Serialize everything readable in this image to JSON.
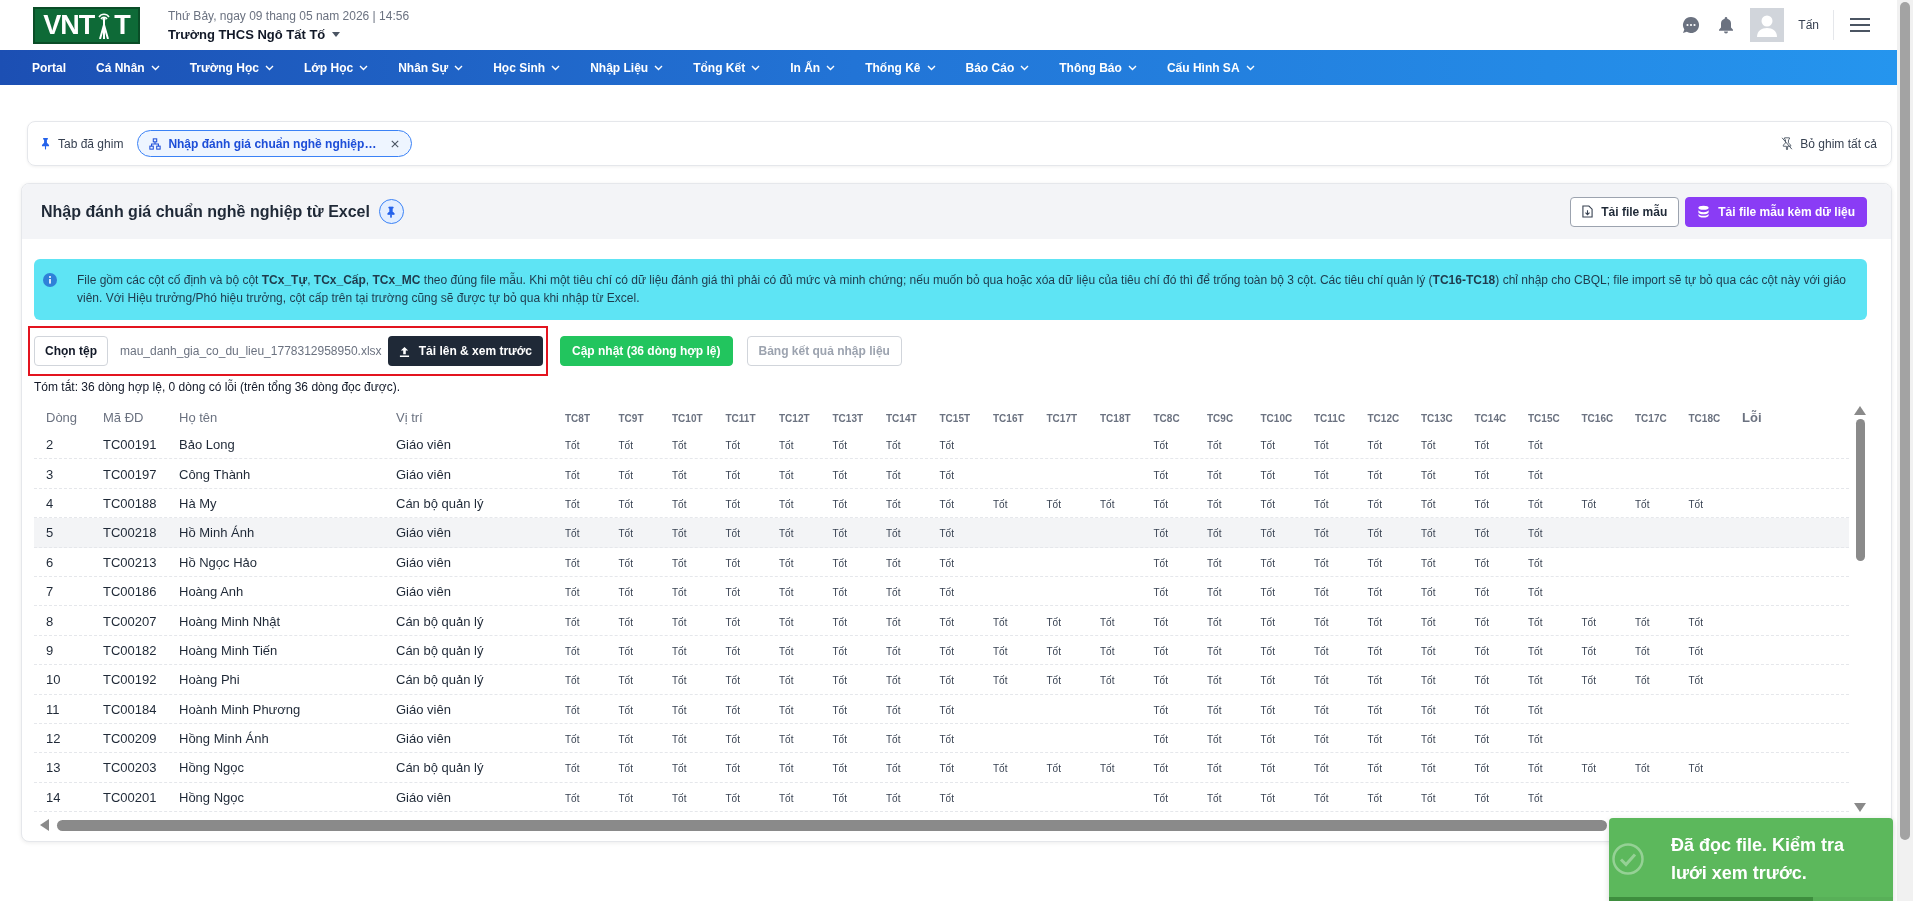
{
  "header": {
    "logo": {
      "text_left": "VNT",
      "text_right": "T"
    },
    "date_time": "Thứ Bảy, ngay 09 thang 05 nam 2026 | 14:56",
    "school": "Trường THCS Ngô Tất Tố",
    "user_name": "Tấn"
  },
  "nav": [
    {
      "label": "Portal",
      "has_menu": false
    },
    {
      "label": "Cá Nhân",
      "has_menu": true
    },
    {
      "label": "Trường Học",
      "has_menu": true
    },
    {
      "label": "Lớp Học",
      "has_menu": true
    },
    {
      "label": "Nhân Sự",
      "has_menu": true
    },
    {
      "label": "Học Sinh",
      "has_menu": true
    },
    {
      "label": "Nhập Liệu",
      "has_menu": true
    },
    {
      "label": "Tổng Kết",
      "has_menu": true
    },
    {
      "label": "In Ấn",
      "has_menu": true
    },
    {
      "label": "Thống Kê",
      "has_menu": true
    },
    {
      "label": "Báo Cáo",
      "has_menu": true
    },
    {
      "label": "Thông Báo",
      "has_menu": true
    },
    {
      "label": "Cấu Hình SA",
      "has_menu": true
    }
  ],
  "pinned_bar": {
    "label": "Tab đã ghim",
    "tabs": [
      {
        "label": "Nhập đánh giá chuẩn nghề nghiệp…",
        "selected": true
      }
    ],
    "unpin_all": "Bỏ ghim tất cả"
  },
  "page": {
    "title": "Nhập đánh giá chuẩn nghề nghiệp từ Excel",
    "pinned": true,
    "buttons": [
      {
        "label": "Tải file mẫu",
        "kind": "outline"
      },
      {
        "label": "Tải file mẫu kèm dữ liệu",
        "kind": "primary"
      }
    ]
  },
  "notice": {
    "text": "File gồm các cột cố định và bộ cột **TCx_Tự**, **TCx_Cấp**, **TCx_MC** theo đúng file mẫu. Khi một tiêu chí có dữ liệu đánh giá thì phải có đủ mức và minh chứng; nếu muốn bỏ qua hoặc xóa dữ liệu của tiêu chí đó thì để trống toàn bộ 3 cột. Các tiêu chí quản lý (**TC16-TC18**) chỉ nhập cho CBQL; file import sẽ tự bỏ qua các cột này với giáo viên. Với Hiệu trưởng/Phó hiệu trưởng, cột cấp trên tại trường cũng sẽ được tự bỏ qua khi nhập từ Excel."
  },
  "import": {
    "highlighted": true,
    "choose_button": "Chọn tệp",
    "file_name": "mau_danh_gia_co_du_lieu_1778312958950.xlsx",
    "upload_button": "Tải lên & xem trước",
    "actions": [
      {
        "label": "Cập nhật (36 dòng hợp lệ)",
        "disabled": false
      },
      {
        "label": "Bảng kết quả nhập liệu",
        "disabled": true
      }
    ]
  },
  "summary": "Tóm tắt: 36 dòng hợp lệ, 0 dòng có lỗi (trên tổng 36 dòng đọc được).",
  "table": {
    "columns": [
      {
        "label": "Dòng",
        "kind": "info"
      },
      {
        "label": "Mã ĐD",
        "kind": "info"
      },
      {
        "label": "Họ tên",
        "kind": "info"
      },
      {
        "label": "Vị trí",
        "kind": "info"
      },
      {
        "label": "TC8T",
        "kind": "rating_t"
      },
      {
        "label": "TC9T",
        "kind": "rating_t"
      },
      {
        "label": "TC10T",
        "kind": "rating_t"
      },
      {
        "label": "TC11T",
        "kind": "rating_t"
      },
      {
        "label": "TC12T",
        "kind": "rating_t"
      },
      {
        "label": "TC13T",
        "kind": "rating_t"
      },
      {
        "label": "TC14T",
        "kind": "rating_t"
      },
      {
        "label": "TC15T",
        "kind": "rating_t"
      },
      {
        "label": "TC16T",
        "kind": "rating_t"
      },
      {
        "label": "TC17T",
        "kind": "rating_t"
      },
      {
        "label": "TC18T",
        "kind": "rating_t"
      },
      {
        "label": "TC8C",
        "kind": "rating_c"
      },
      {
        "label": "TC9C",
        "kind": "rating_c"
      },
      {
        "label": "TC10C",
        "kind": "rating_c"
      },
      {
        "label": "TC11C",
        "kind": "rating_c"
      },
      {
        "label": "TC12C",
        "kind": "rating_c"
      },
      {
        "label": "TC13C",
        "kind": "rating_c"
      },
      {
        "label": "TC14C",
        "kind": "rating_c"
      },
      {
        "label": "TC15C",
        "kind": "rating_c"
      },
      {
        "label": "TC16C",
        "kind": "rating_c"
      },
      {
        "label": "TC17C",
        "kind": "rating_c"
      },
      {
        "label": "TC18C",
        "kind": "rating_c"
      },
      {
        "label": "Lỗi",
        "kind": "error"
      }
    ],
    "rows": [
      {
        "line": "2",
        "code": "TC00191",
        "name": "Bảo Long",
        "position": "Giáo viên",
        "hovered": false,
        "ratings_t": [
          "Tốt",
          "Tốt",
          "Tốt",
          "Tốt",
          "Tốt",
          "Tốt",
          "Tốt",
          "Tốt"
        ],
        "ratings_c": [
          "Tốt",
          "Tốt",
          "Tốt",
          "Tốt",
          "Tốt",
          "Tốt",
          "Tốt",
          "Tốt"
        ]
      },
      {
        "line": "3",
        "code": "TC00197",
        "name": "Công Thành",
        "position": "Giáo viên",
        "hovered": false,
        "ratings_t": [
          "Tốt",
          "Tốt",
          "Tốt",
          "Tốt",
          "Tốt",
          "Tốt",
          "Tốt",
          "Tốt"
        ],
        "ratings_c": [
          "Tốt",
          "Tốt",
          "Tốt",
          "Tốt",
          "Tốt",
          "Tốt",
          "Tốt",
          "Tốt"
        ]
      },
      {
        "line": "4",
        "code": "TC00188",
        "name": "Hà My",
        "position": "Cán bộ quản lý",
        "hovered": false,
        "ratings_t": [
          "Tốt",
          "Tốt",
          "Tốt",
          "Tốt",
          "Tốt",
          "Tốt",
          "Tốt",
          "Tốt",
          "Tốt",
          "Tốt",
          "Tốt"
        ],
        "ratings_c": [
          "Tốt",
          "Tốt",
          "Tốt",
          "Tốt",
          "Tốt",
          "Tốt",
          "Tốt",
          "Tốt",
          "Tốt",
          "Tốt",
          "Tốt"
        ]
      },
      {
        "line": "5",
        "code": "TC00218",
        "name": "Hồ Minh Ánh",
        "position": "Giáo viên",
        "hovered": true,
        "ratings_t": [
          "Tốt",
          "Tốt",
          "Tốt",
          "Tốt",
          "Tốt",
          "Tốt",
          "Tốt",
          "Tốt"
        ],
        "ratings_c": [
          "Tốt",
          "Tốt",
          "Tốt",
          "Tốt",
          "Tốt",
          "Tốt",
          "Tốt",
          "Tốt"
        ]
      },
      {
        "line": "6",
        "code": "TC00213",
        "name": "Hồ Ngọc Hảo",
        "position": "Giáo viên",
        "hovered": false,
        "ratings_t": [
          "Tốt",
          "Tốt",
          "Tốt",
          "Tốt",
          "Tốt",
          "Tốt",
          "Tốt",
          "Tốt"
        ],
        "ratings_c": [
          "Tốt",
          "Tốt",
          "Tốt",
          "Tốt",
          "Tốt",
          "Tốt",
          "Tốt",
          "Tốt"
        ]
      },
      {
        "line": "7",
        "code": "TC00186",
        "name": "Hoàng Anh",
        "position": "Giáo viên",
        "hovered": false,
        "ratings_t": [
          "Tốt",
          "Tốt",
          "Tốt",
          "Tốt",
          "Tốt",
          "Tốt",
          "Tốt",
          "Tốt"
        ],
        "ratings_c": [
          "Tốt",
          "Tốt",
          "Tốt",
          "Tốt",
          "Tốt",
          "Tốt",
          "Tốt",
          "Tốt"
        ]
      },
      {
        "line": "8",
        "code": "TC00207",
        "name": "Hoàng Minh Nhật",
        "position": "Cán bộ quản lý",
        "hovered": false,
        "ratings_t": [
          "Tốt",
          "Tốt",
          "Tốt",
          "Tốt",
          "Tốt",
          "Tốt",
          "Tốt",
          "Tốt",
          "Tốt",
          "Tốt",
          "Tốt"
        ],
        "ratings_c": [
          "Tốt",
          "Tốt",
          "Tốt",
          "Tốt",
          "Tốt",
          "Tốt",
          "Tốt",
          "Tốt",
          "Tốt",
          "Tốt",
          "Tốt"
        ]
      },
      {
        "line": "9",
        "code": "TC00182",
        "name": "Hoàng Minh Tiến",
        "position": "Cán bộ quản lý",
        "hovered": false,
        "ratings_t": [
          "Tốt",
          "Tốt",
          "Tốt",
          "Tốt",
          "Tốt",
          "Tốt",
          "Tốt",
          "Tốt",
          "Tốt",
          "Tốt",
          "Tốt"
        ],
        "ratings_c": [
          "Tốt",
          "Tốt",
          "Tốt",
          "Tốt",
          "Tốt",
          "Tốt",
          "Tốt",
          "Tốt",
          "Tốt",
          "Tốt",
          "Tốt"
        ]
      },
      {
        "line": "10",
        "code": "TC00192",
        "name": "Hoàng Phi",
        "position": "Cán bộ quản lý",
        "hovered": false,
        "ratings_t": [
          "Tốt",
          "Tốt",
          "Tốt",
          "Tốt",
          "Tốt",
          "Tốt",
          "Tốt",
          "Tốt",
          "Tốt",
          "Tốt",
          "Tốt"
        ],
        "ratings_c": [
          "Tốt",
          "Tốt",
          "Tốt",
          "Tốt",
          "Tốt",
          "Tốt",
          "Tốt",
          "Tốt",
          "Tốt",
          "Tốt",
          "Tốt"
        ]
      },
      {
        "line": "11",
        "code": "TC00184",
        "name": "Hoành Minh Phương",
        "position": "Giáo viên",
        "hovered": false,
        "ratings_t": [
          "Tốt",
          "Tốt",
          "Tốt",
          "Tốt",
          "Tốt",
          "Tốt",
          "Tốt",
          "Tốt"
        ],
        "ratings_c": [
          "Tốt",
          "Tốt",
          "Tốt",
          "Tốt",
          "Tốt",
          "Tốt",
          "Tốt",
          "Tốt"
        ]
      },
      {
        "line": "12",
        "code": "TC00209",
        "name": "Hồng Minh Ánh",
        "position": "Giáo viên",
        "hovered": false,
        "ratings_t": [
          "Tốt",
          "Tốt",
          "Tốt",
          "Tốt",
          "Tốt",
          "Tốt",
          "Tốt",
          "Tốt"
        ],
        "ratings_c": [
          "Tốt",
          "Tốt",
          "Tốt",
          "Tốt",
          "Tốt",
          "Tốt",
          "Tốt",
          "Tốt"
        ]
      },
      {
        "line": "13",
        "code": "TC00203",
        "name": "Hồng Ngọc",
        "position": "Cán bộ quản lý",
        "hovered": false,
        "ratings_t": [
          "Tốt",
          "Tốt",
          "Tốt",
          "Tốt",
          "Tốt",
          "Tốt",
          "Tốt",
          "Tốt",
          "Tốt",
          "Tốt",
          "Tốt"
        ],
        "ratings_c": [
          "Tốt",
          "Tốt",
          "Tốt",
          "Tốt",
          "Tốt",
          "Tốt",
          "Tốt",
          "Tốt",
          "Tốt",
          "Tốt",
          "Tốt"
        ]
      },
      {
        "line": "14",
        "code": "TC00201",
        "name": "Hồng Ngọc",
        "position": "Giáo viên",
        "hovered": false,
        "ratings_t": [
          "Tốt",
          "Tốt",
          "Tốt",
          "Tốt",
          "Tốt",
          "Tốt",
          "Tốt",
          "Tốt"
        ],
        "ratings_c": [
          "Tốt",
          "Tốt",
          "Tốt",
          "Tốt",
          "Tốt",
          "Tốt",
          "Tốt",
          "Tốt"
        ]
      }
    ]
  },
  "toast": {
    "message": "Đã đọc file. Kiểm tra lưới xem trước.",
    "level": 0.72
  }
}
